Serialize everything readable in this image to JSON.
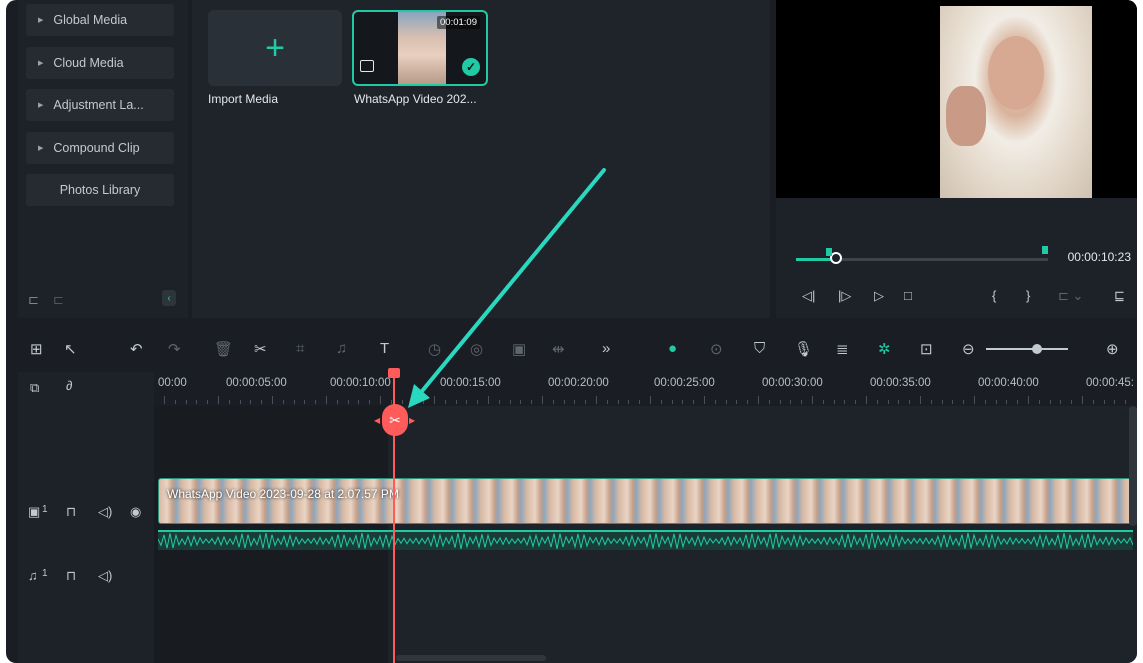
{
  "sidebar": {
    "items": [
      {
        "label": "Global Media",
        "expandable": true
      },
      {
        "label": "Cloud Media",
        "expandable": true
      },
      {
        "label": "Adjustment La...",
        "expandable": true
      },
      {
        "label": "Compound Clip",
        "expandable": true
      },
      {
        "label": "Photos Library",
        "expandable": false
      }
    ],
    "footer_icons": [
      "new-folder-icon",
      "folder-icon",
      "collapse-icon"
    ]
  },
  "media": {
    "import_label": "Import Media",
    "video_label": "WhatsApp Video 202...",
    "video_duration": "00:01:09"
  },
  "player": {
    "timecode": "00:00:10:23",
    "progress": 0.16,
    "controls": [
      "prev-frame-icon",
      "next-frame-icon",
      "play-icon",
      "stop-icon",
      "mark-in-icon",
      "mark-out-icon",
      "more-icon",
      "display-icon"
    ]
  },
  "toolbar": {
    "icons": [
      "grid-icon",
      "select-icon",
      "undo-icon",
      "redo-icon",
      "delete-icon",
      "scissors-icon",
      "crop-icon",
      "audio-icon",
      "text-icon",
      "speed-icon",
      "color-icon",
      "screen-icon",
      "transition-icon",
      "more-icon",
      "ai-icon",
      "render-icon",
      "marker-icon",
      "mic-icon",
      "voiceover-icon",
      "ai-tools-icon",
      "fit-icon",
      "zoom-out-icon",
      "zoom-in-icon"
    ],
    "zoom_level": 0.62
  },
  "ruler": {
    "labels": [
      "00:00",
      "00:00:05:00",
      "00:00:10:00",
      "00:00:15:00",
      "00:00:20:00",
      "00:00:25:00",
      "00:00:30:00",
      "00:00:35:00",
      "00:00:40:00",
      "00:00:45:"
    ]
  },
  "tracks": {
    "video": {
      "index": "1",
      "clip_title": "WhatsApp Video 2023-09-28 at 2.07.57 PM"
    },
    "audio": {
      "index": "1"
    }
  },
  "colors": {
    "accent": "#22c9a5",
    "playhead": "#ff5b5b",
    "background": "#1a1e24"
  }
}
